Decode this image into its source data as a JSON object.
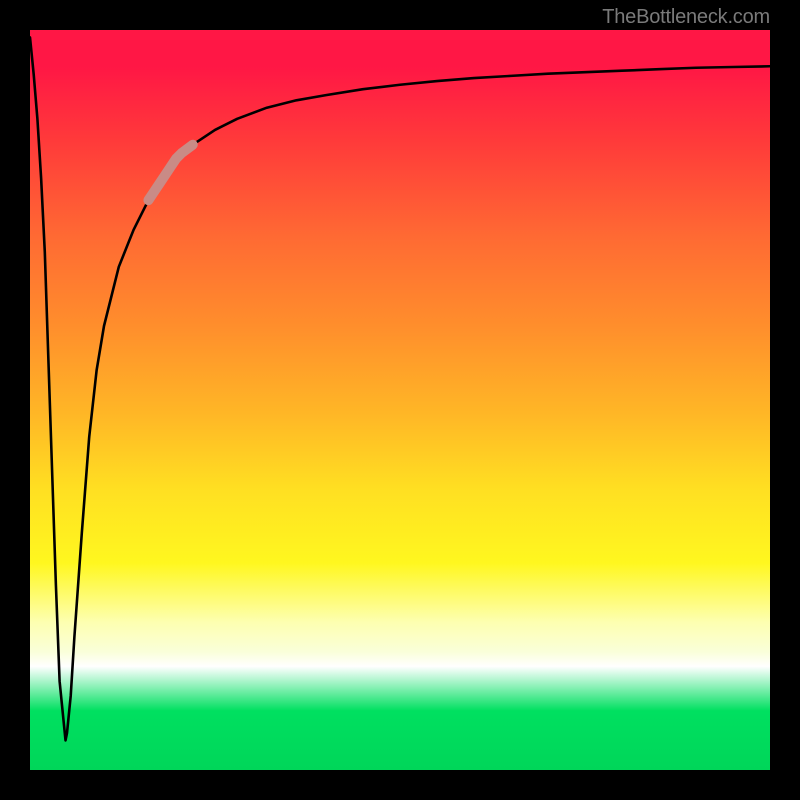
{
  "watermark": "TheBottleneck.com",
  "chart_data": {
    "type": "line",
    "title": "",
    "xlabel": "",
    "ylabel": "",
    "xlim": [
      0,
      100
    ],
    "ylim": [
      0,
      100
    ],
    "x": [
      0,
      0.5,
      1,
      1.5,
      2,
      2.5,
      3,
      3.5,
      4,
      4.8,
      5,
      5.5,
      6,
      7,
      8,
      9,
      10,
      12,
      14,
      16,
      18,
      20,
      22,
      25,
      28,
      32,
      36,
      40,
      45,
      50,
      55,
      60,
      65,
      70,
      75,
      80,
      85,
      90,
      95,
      100
    ],
    "values": [
      99,
      94,
      88,
      80,
      70,
      55,
      40,
      25,
      12,
      4,
      5,
      10,
      18,
      32,
      45,
      54,
      60,
      68,
      73,
      77,
      80,
      83,
      84.5,
      86.5,
      88,
      89.5,
      90.5,
      91.2,
      92,
      92.6,
      93.1,
      93.5,
      93.8,
      94.1,
      94.3,
      94.5,
      94.7,
      94.9,
      95,
      95.1
    ],
    "highlight_segment": {
      "x_start": 16,
      "x_end": 22,
      "color": "#c98b86"
    },
    "background": "red-yellow-green vertical gradient"
  }
}
